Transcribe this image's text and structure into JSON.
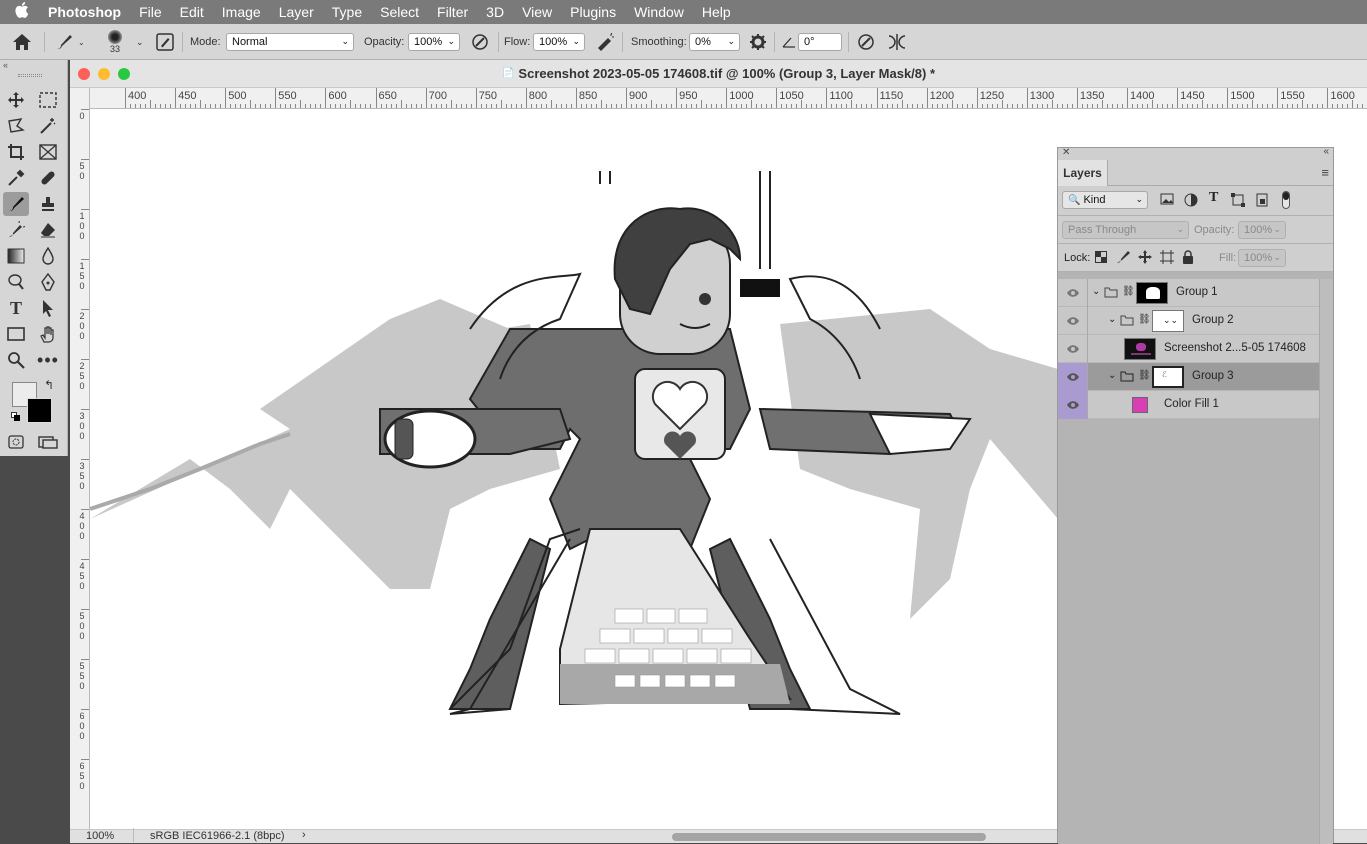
{
  "menubar": {
    "apple": "",
    "app_name": "Photoshop",
    "items": [
      "File",
      "Edit",
      "Image",
      "Layer",
      "Type",
      "Select",
      "Filter",
      "3D",
      "View",
      "Plugins",
      "Window",
      "Help"
    ]
  },
  "options": {
    "brush_size": "33",
    "mode_label": "Mode:",
    "mode_value": "Normal",
    "opacity_label": "Opacity:",
    "opacity_value": "100%",
    "flow_label": "Flow:",
    "flow_value": "100%",
    "smoothing_label": "Smoothing:",
    "smoothing_value": "0%",
    "angle_value": "0°"
  },
  "document": {
    "title": "Screenshot 2023-05-05 174608.tif @ 100% (Group 3, Layer Mask/8) *",
    "ruler_labels": [
      "400",
      "450",
      "500",
      "550",
      "600",
      "650",
      "700",
      "750",
      "800",
      "850",
      "900",
      "950",
      "1000",
      "1050",
      "1100",
      "1150",
      "1200",
      "1250",
      "1300",
      "1350",
      "1400",
      "1450",
      "1500",
      "1550",
      "1600"
    ],
    "vruler_labels": [
      "0",
      "50",
      "100",
      "150",
      "200",
      "250",
      "300",
      "350",
      "400",
      "450",
      "500",
      "550",
      "600",
      "650"
    ],
    "zoom": "100%",
    "profile": "sRGB IEC61966-2.1 (8bpc)"
  },
  "layers_panel": {
    "tab": "Layers",
    "filter_kind": "Kind",
    "blend_mode": "Pass Through",
    "opacity_label": "Opacity:",
    "opacity_value": "100%",
    "lock_label": "Lock:",
    "fill_label": "Fill:",
    "fill_value": "100%",
    "layers": [
      {
        "name": "Group 1",
        "type": "group"
      },
      {
        "name": "Group 2",
        "type": "group"
      },
      {
        "name": "Screenshot 2...5-05 174608",
        "type": "image"
      },
      {
        "name": "Group 3",
        "type": "group",
        "selected": true
      },
      {
        "name": "Color Fill 1",
        "type": "fill",
        "swatch": "#d83fb4"
      }
    ]
  },
  "colors": {
    "selected_layer": "#9b9b9b",
    "purple_mark": "#a99bd0",
    "fill_swatch": "#d83fb4",
    "close": "#fe5f57",
    "minimize": "#febc2e",
    "zoom": "#28c840"
  }
}
